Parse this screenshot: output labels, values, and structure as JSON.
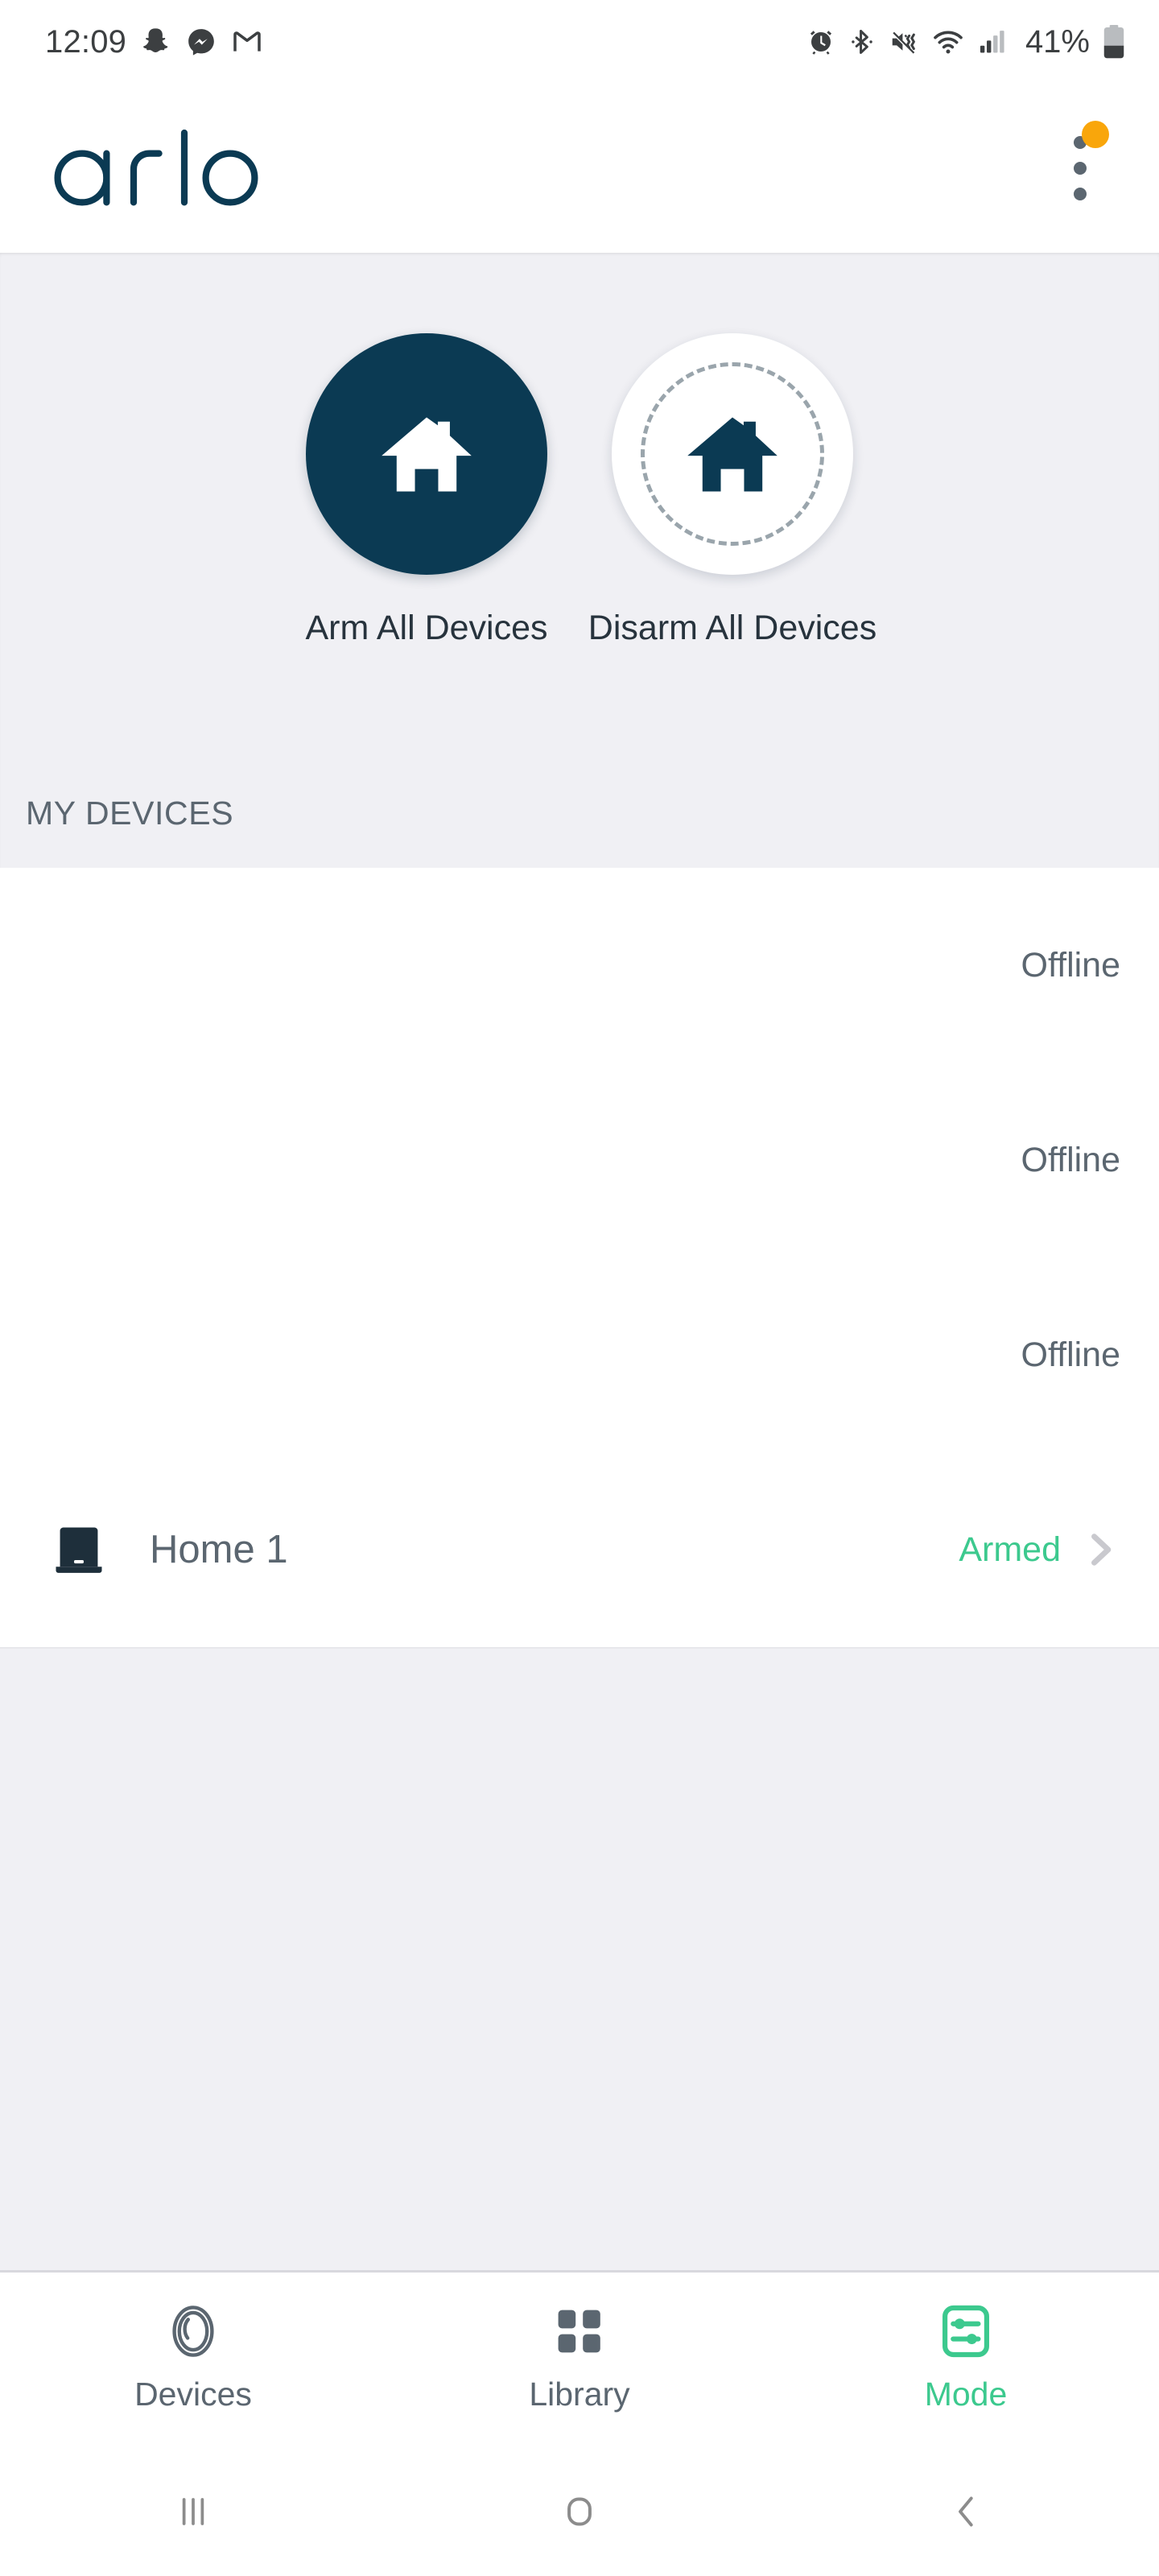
{
  "status_bar": {
    "time": "12:09",
    "battery_percent": "41%",
    "left_icons": [
      "snapchat-icon",
      "messenger-icon",
      "gmail-icon"
    ],
    "right_icons": [
      "alarm-icon",
      "bluetooth-icon",
      "mute-vibrate-icon",
      "wifi-icon",
      "cellular-signal-icon",
      "battery-icon"
    ]
  },
  "app_bar": {
    "brand": "arlo",
    "brand_color": "#0B3A53",
    "overflow_menu_icon": "three-dots-vertical-icon",
    "notification_badge_color": "#F9A60B"
  },
  "mode_panel": {
    "background_color": "#F0F0F4",
    "actions": [
      {
        "label": "Arm All Devices",
        "icon": "house-icon",
        "state": "armed",
        "selected": true
      },
      {
        "label": "Disarm All Devices",
        "icon": "house-icon",
        "state": "disarmed",
        "selected": false
      }
    ],
    "section_title": "MY DEVICES"
  },
  "devices": {
    "rows": [
      {
        "name": "",
        "status": "Offline",
        "status_state": "offline",
        "icon": "",
        "chevron": false
      },
      {
        "name": "",
        "status": "Offline",
        "status_state": "offline",
        "icon": "",
        "chevron": false
      },
      {
        "name": "",
        "status": "Offline",
        "status_state": "offline",
        "icon": "",
        "chevron": false
      },
      {
        "name": "Home 1",
        "status": "Armed",
        "status_state": "armed",
        "icon": "basestation-icon",
        "chevron": true
      }
    ],
    "armed_color": "#3CC98E",
    "offline_color": "#5B6670"
  },
  "tab_bar": {
    "active_color": "#3CC98E",
    "inactive_color": "#5B6670",
    "tabs": [
      {
        "label": "Devices",
        "icon": "camera-lens-icon",
        "active": false
      },
      {
        "label": "Library",
        "icon": "grid-four-icon",
        "active": false
      },
      {
        "label": "Mode",
        "icon": "sliders-icon",
        "active": true
      }
    ]
  },
  "android_nav": {
    "buttons": [
      {
        "name": "recents",
        "icon": "recents-bars-icon"
      },
      {
        "name": "home",
        "icon": "home-square-icon"
      },
      {
        "name": "back",
        "icon": "back-chevron-icon"
      }
    ]
  }
}
